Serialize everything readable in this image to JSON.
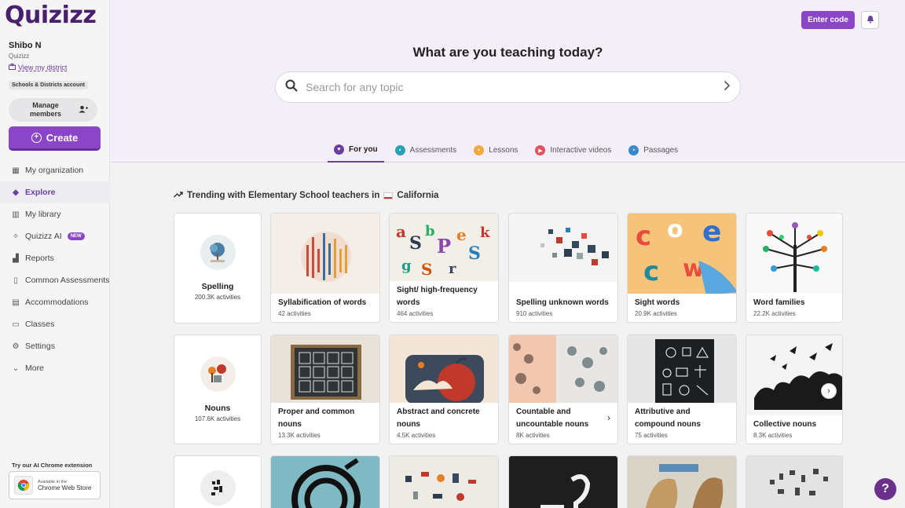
{
  "brand": {
    "logo": "Quizizz",
    "accent": "#8b45c7"
  },
  "user": {
    "name": "Shibo N",
    "org": "Quizizz",
    "district_link": "View my district",
    "account_badge": "Schools & Districts account"
  },
  "sidebar": {
    "manage_label": "Manage members",
    "create_label": "Create",
    "items": [
      {
        "label": "My organization",
        "icon": "building-icon"
      },
      {
        "label": "Explore",
        "icon": "compass-icon",
        "active": true
      },
      {
        "label": "My library",
        "icon": "library-icon"
      },
      {
        "label": "Quizizz AI",
        "icon": "sparkle-icon",
        "badge": "NEW"
      },
      {
        "label": "Reports",
        "icon": "chart-icon"
      },
      {
        "label": "Common Assessments",
        "icon": "document-icon"
      },
      {
        "label": "Accommodations",
        "icon": "accommodation-icon"
      },
      {
        "label": "Classes",
        "icon": "classes-icon"
      },
      {
        "label": "Settings",
        "icon": "gear-icon"
      },
      {
        "label": "More",
        "icon": "chevron-down-icon"
      }
    ],
    "extension_title": "Try our AI Chrome extension",
    "extension_line1": "Available in the",
    "extension_line2": "Chrome Web Store"
  },
  "header": {
    "enter_code": "Enter code",
    "title": "What are you teaching today?",
    "search_placeholder": "Search for any topic",
    "tabs": [
      {
        "label": "For you",
        "color": "#6b3fa0",
        "active": true
      },
      {
        "label": "Assessments",
        "color": "#2aa1b5"
      },
      {
        "label": "Lessons",
        "color": "#f0a93a"
      },
      {
        "label": "Interactive videos",
        "color": "#e0525e"
      },
      {
        "label": "Passages",
        "color": "#3a87c9"
      }
    ]
  },
  "section": {
    "title": "Trending with Elementary School teachers in",
    "place": "California"
  },
  "row1": {
    "category": {
      "name": "Spelling",
      "count": "200.3K activities"
    },
    "cards": [
      {
        "name": "Syllabification of words",
        "count": "42 activities"
      },
      {
        "name": "Sight/ high-frequency words",
        "count": "464 activities"
      },
      {
        "name": "Spelling unknown words",
        "count": "910 activities"
      },
      {
        "name": "Sight words",
        "count": "20.9K activities"
      },
      {
        "name": "Word families",
        "count": "22.2K activities"
      }
    ]
  },
  "row2": {
    "category": {
      "name": "Nouns",
      "count": "107.6K activities"
    },
    "cards": [
      {
        "name": "Proper and common nouns",
        "count": "13.3K activities"
      },
      {
        "name": "Abstract and concrete nouns",
        "count": "4.5K activities"
      },
      {
        "name": "Countable and uncountable nouns",
        "count": "8K activities"
      },
      {
        "name": "Attributive and compound nouns",
        "count": "75 activities"
      },
      {
        "name": "Collective nouns",
        "count": "8.3K activities"
      }
    ]
  },
  "help_label": "?"
}
